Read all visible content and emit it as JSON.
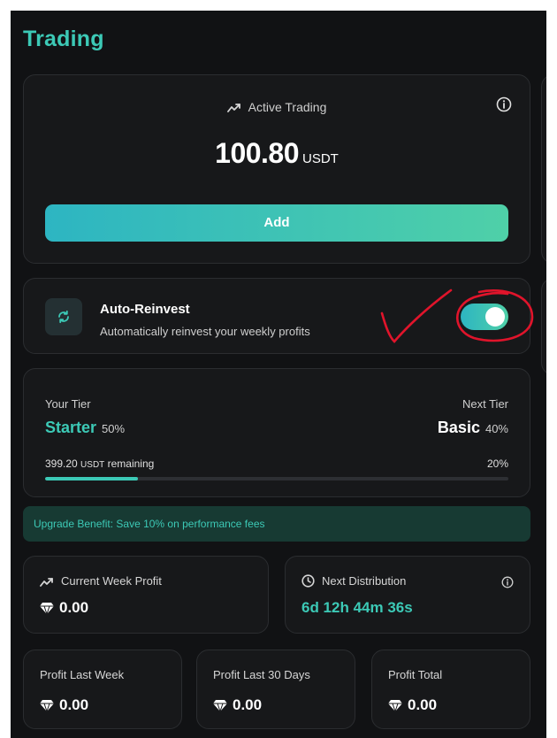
{
  "page": {
    "title": "Trading"
  },
  "active_trading": {
    "label": "Active Trading",
    "amount": "100.80",
    "unit": "USDT",
    "add_label": "Add"
  },
  "auto_reinvest": {
    "title": "Auto-Reinvest",
    "description": "Automatically reinvest your weekly profits",
    "enabled": true
  },
  "tier": {
    "current_label": "Your Tier",
    "current_name": "Starter",
    "current_pct": "50%",
    "next_label": "Next Tier",
    "next_name": "Basic",
    "next_pct": "40%",
    "remaining_amount": "399.20",
    "remaining_unit": "USDT",
    "remaining_suffix": "remaining",
    "progress_text": "20%",
    "progress_fraction": 0.2
  },
  "upgrade": {
    "text": "Upgrade Benefit: Save 10% on performance fees"
  },
  "stats": {
    "current_week_label": "Current Week Profit",
    "current_week_value": "0.00",
    "next_distribution_label": "Next Distribution",
    "next_distribution_value": "6d 12h 44m 36s",
    "last_week_label": "Profit Last Week",
    "last_week_value": "0.00",
    "last_30_label": "Profit Last 30 Days",
    "last_30_value": "0.00",
    "total_label": "Profit Total",
    "total_value": "0.00"
  },
  "colors": {
    "accent": "#3cc9b6",
    "gradient_start": "#2db5c2",
    "gradient_end": "#4fd0a8",
    "background": "#111214",
    "card": "#17181a",
    "annotation": "#e0142b"
  }
}
